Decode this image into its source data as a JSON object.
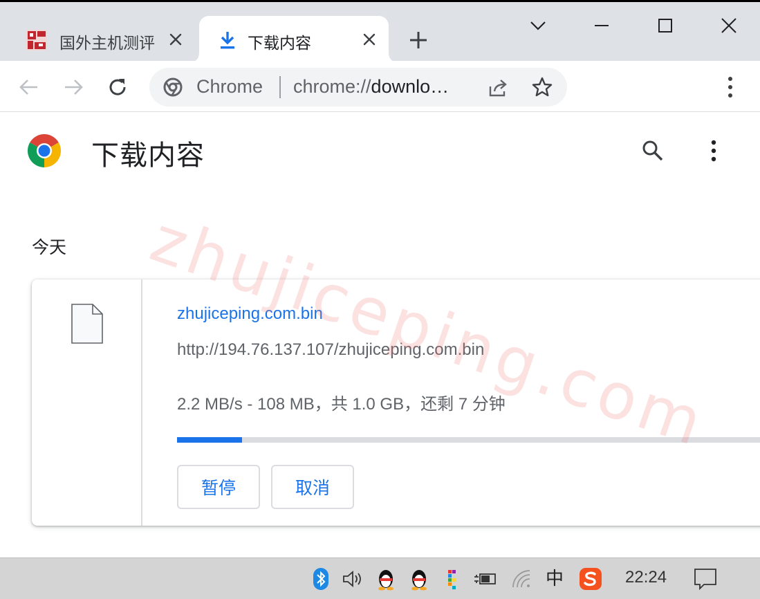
{
  "tabs": [
    {
      "title": "国外主机测评",
      "active": false,
      "favicon": "red-stamp-favicon"
    },
    {
      "title": "下载内容",
      "active": true,
      "favicon": "download-icon"
    }
  ],
  "toolbar": {
    "chip": "Chrome",
    "url_prefix": "chrome://",
    "url_host": "downlo…"
  },
  "page": {
    "title": "下载内容",
    "section_date": "今天"
  },
  "download": {
    "file_name": "zhujiceping.com.bin",
    "url": "http://194.76.137.107/zhujiceping.com.bin",
    "status": "2.2 MB/s - 108 MB，共 1.0 GB，还剩 7 分钟",
    "progress_fraction": 0.108,
    "pause_label": "暂停",
    "cancel_label": "取消"
  },
  "watermark": "zhujiceping.com",
  "taskbar": {
    "clock": "22:24",
    "ime": "中"
  },
  "colors": {
    "accent": "#1a73e8",
    "tabstrip": "#dee1e6",
    "taskbar": "#d4d4d4"
  }
}
